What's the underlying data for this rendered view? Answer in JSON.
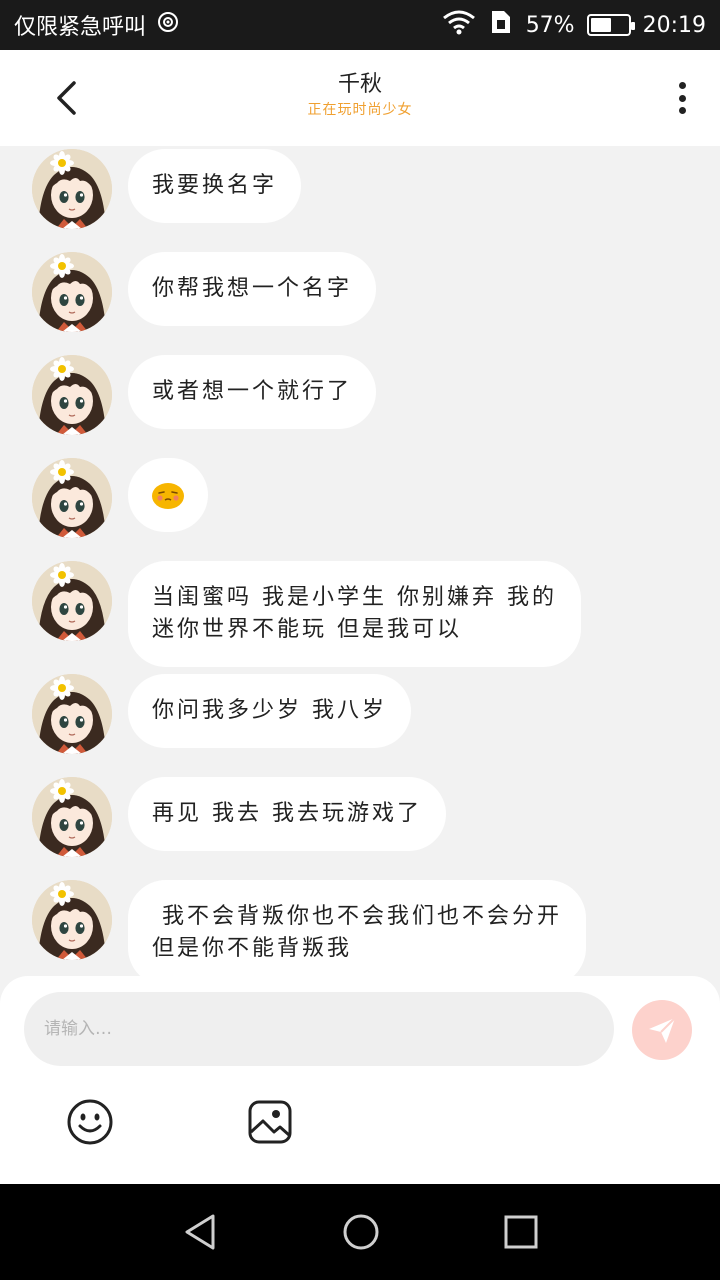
{
  "status_bar": {
    "carrier_text": "仅限紧急呼叫",
    "battery_text": "57%",
    "battery_level": 0.57,
    "time": "20:19"
  },
  "header": {
    "title": "千秋",
    "subtitle": "正在玩时尚少女"
  },
  "messages": [
    {
      "text": "我要换名字"
    },
    {
      "text": "你帮我想一个名字"
    },
    {
      "text": "或者想一个就行了"
    },
    {
      "text": "",
      "emoji": "shy-face-emoji"
    },
    {
      "text": "当闺蜜吗 我是小学生 你别嫌弃 我的\n迷你世界不能玩 但是我可以"
    },
    {
      "text": "你问我多少岁 我八岁"
    },
    {
      "text": "再见 我去 我去玩游戏了"
    },
    {
      "text": " 我不会背叛你也不会我们也不会分开\n但是你不能背叛我"
    }
  ],
  "composer": {
    "placeholder": "请输入…",
    "value": ""
  },
  "icons": {
    "back": "chevron-left-icon",
    "more": "more-vertical-icon",
    "send": "paper-plane-icon",
    "emoji": "smiley-icon",
    "image": "image-icon",
    "nav_back": "triangle-back-icon",
    "nav_home": "circle-home-icon",
    "nav_recent": "square-recent-icon"
  },
  "colors": {
    "subtitle": "#f0a030",
    "send_button": "#fdd2cc",
    "chat_background": "#f2f2f2",
    "bubble": "#ffffff"
  }
}
